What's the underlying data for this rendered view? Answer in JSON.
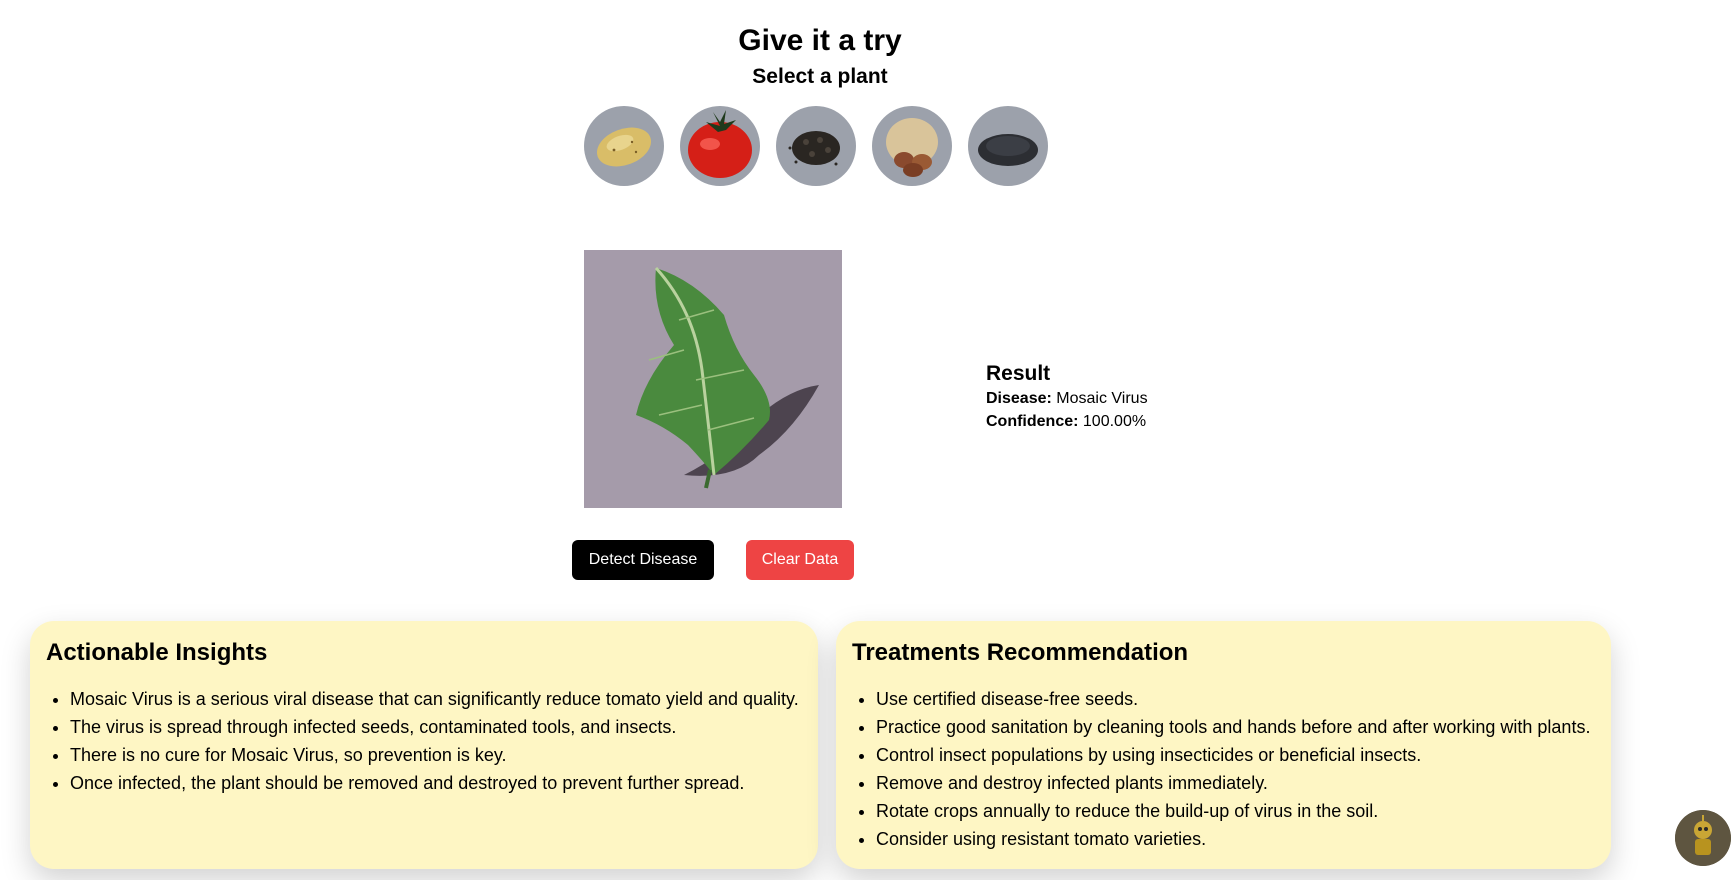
{
  "header": {
    "title": "Give it a try",
    "subtitle": "Select a plant"
  },
  "plants": [
    {
      "icon": "potato-icon"
    },
    {
      "icon": "tomato-icon"
    },
    {
      "icon": "black-seeds-icon"
    },
    {
      "icon": "peanut-icon"
    },
    {
      "icon": "seeds-pile-icon"
    }
  ],
  "result": {
    "heading": "Result",
    "disease_label": "Disease:",
    "disease_value": "Mosaic Virus",
    "confidence_label": "Confidence:",
    "confidence_value": "100.00%"
  },
  "actions": {
    "detect_label": "Detect Disease",
    "clear_label": "Clear Data"
  },
  "insights": {
    "title": "Actionable Insights",
    "items": [
      "Mosaic Virus is a serious viral disease that can significantly reduce tomato yield and quality.",
      "The virus is spread through infected seeds, contaminated tools, and insects.",
      "There is no cure for Mosaic Virus, so prevention is key.",
      "Once infected, the plant should be removed and destroyed to prevent further spread."
    ]
  },
  "treatments": {
    "title": "Treatments Recommendation",
    "items": [
      "Use certified disease-free seeds.",
      "Practice good sanitation by cleaning tools and hands before and after working with plants.",
      "Control insect populations by using insecticides or beneficial insects.",
      "Remove and destroy infected plants immediately.",
      "Rotate crops annually to reduce the build-up of virus in the soil.",
      "Consider using resistant tomato varieties."
    ]
  },
  "colors": {
    "card_bg": "#fef6c4",
    "detect_button": "#000000",
    "clear_button": "#ee4444",
    "plant_circle": "#9ca1ab"
  }
}
